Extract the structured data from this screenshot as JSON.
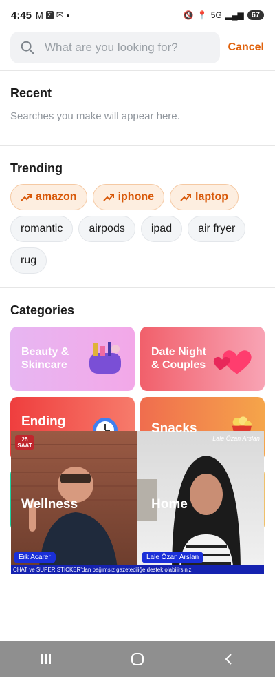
{
  "status": {
    "time": "4:45",
    "network": "5G",
    "battery": "67"
  },
  "search": {
    "placeholder": "What are you looking for?",
    "cancel": "Cancel"
  },
  "recent": {
    "title": "Recent",
    "empty": "Searches you make will appear here."
  },
  "trending": {
    "title": "Trending",
    "hot": [
      "amazon",
      "iphone",
      "laptop"
    ],
    "other": [
      "romantic",
      "airpods",
      "ipad",
      "air fryer",
      "rug"
    ]
  },
  "categories": {
    "title": "Categories",
    "items": [
      {
        "label": "Beauty &\nSkincare",
        "icon": "makeup-bag-icon"
      },
      {
        "label": "Date Night\n& Couples",
        "icon": "hearts-icon"
      },
      {
        "label": "Ending",
        "icon": "alarm-clock-icon"
      },
      {
        "label": "Snacks",
        "icon": "popcorn-icon"
      },
      {
        "label": "Wellness",
        "icon": "dumbbell-icon"
      },
      {
        "label": "Home",
        "icon": "sofa-icon"
      }
    ]
  },
  "video_overlay": {
    "host_left": "Erk Acarer",
    "host_right": "Lale Özan Arslan",
    "signature": "Lale Özan Arslan",
    "logo": "25 SAAT",
    "ticker": "CHAT ve SUPER STICKER'dan bağımsız gazeteciliğe destek olabilirsiniz."
  },
  "colors": {
    "accent": "#e0620d",
    "trending_bg": "#fdeee0",
    "navbar": "#8f8f8f"
  }
}
